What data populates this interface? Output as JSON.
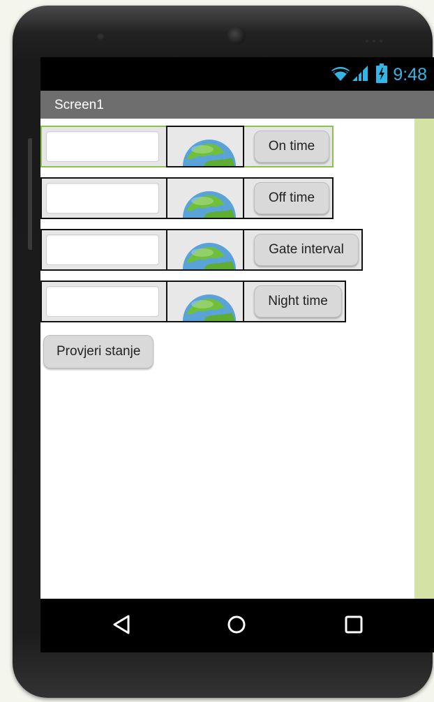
{
  "status_bar": {
    "time": "9:48",
    "icons": [
      "wifi-icon",
      "signal-icon",
      "battery-charging-icon"
    ],
    "icon_color": "#33b5e5"
  },
  "app_bar": {
    "title": "Screen1",
    "background": "#6e6e6e"
  },
  "rows": [
    {
      "text_value": "",
      "image": "globe-icon",
      "button_label": "On time",
      "selected": true
    },
    {
      "text_value": "",
      "image": "globe-icon",
      "button_label": "Off time",
      "selected": false
    },
    {
      "text_value": "",
      "image": "globe-icon",
      "button_label": "Gate interval",
      "selected": false
    },
    {
      "text_value": "",
      "image": "globe-icon",
      "button_label": "Night time",
      "selected": false
    }
  ],
  "check_button": {
    "label": "Provjeri stanje"
  },
  "nav_bar": {
    "icons": [
      "back-icon",
      "home-icon",
      "recents-icon"
    ]
  },
  "colors": {
    "selection_border": "#8bc34a",
    "scroll_strip": "#d4e2a6"
  }
}
